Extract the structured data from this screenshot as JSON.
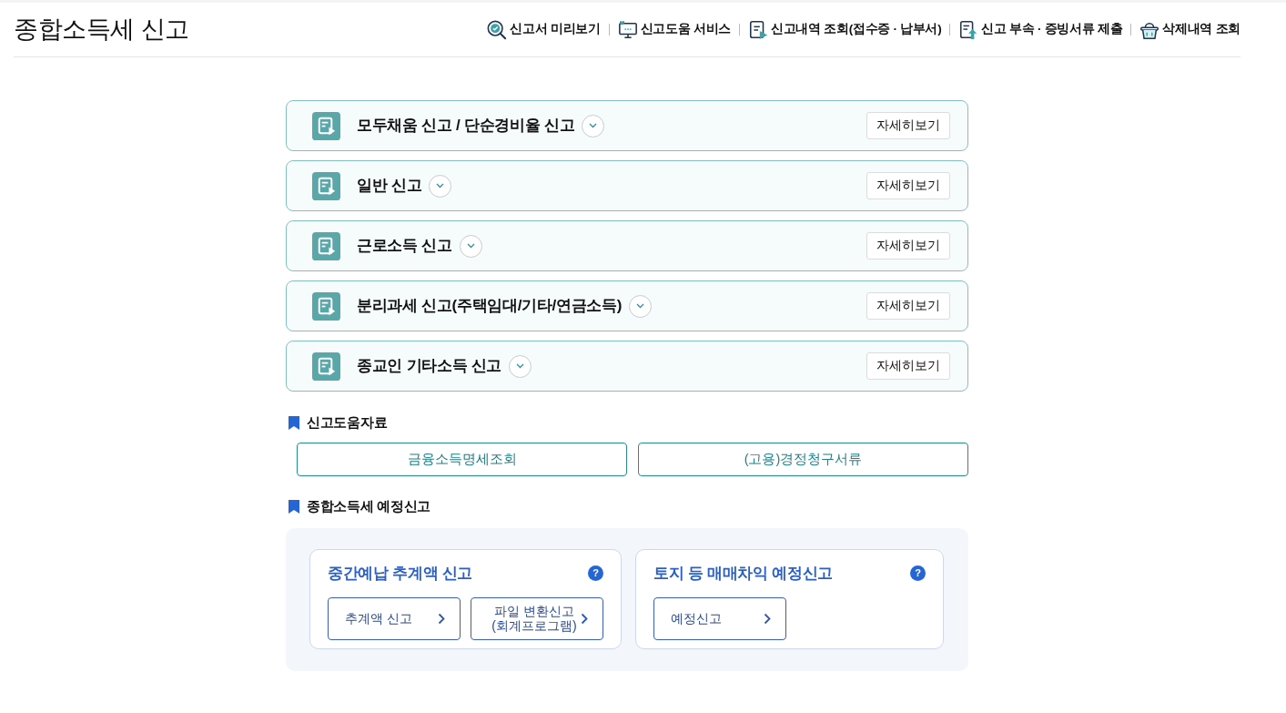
{
  "page_title": "종합소득세 신고",
  "header_links": [
    {
      "label": "신고서 미리보기"
    },
    {
      "label": "신고도움 서비스"
    },
    {
      "label": "신고내역 조회(접수증 · 납부서)"
    },
    {
      "label": "신고 부속 · 증빙서류 제출"
    },
    {
      "label": "삭제내역 조회"
    }
  ],
  "filing_types": [
    {
      "title": "모두채움 신고 / 단순경비율 신고",
      "expanded": false,
      "button": "자세히보기"
    },
    {
      "title": "일반 신고",
      "expanded": false,
      "button": "자세히보기"
    },
    {
      "title": "근로소득 신고",
      "expanded": false,
      "button": "자세히보기"
    },
    {
      "title": "분리과세 신고(주택임대/기타/연금소득)",
      "expanded": false,
      "button": "자세히보기"
    },
    {
      "title": "종교인 기타소득 신고",
      "expanded": false,
      "button": "자세히보기"
    }
  ],
  "help_materials": {
    "heading": "신고도움자료",
    "buttons": [
      "금융소득명세조회",
      "(고용)경정청구서류"
    ]
  },
  "provisional_filing": {
    "heading": "종합소득세 예정신고",
    "cards": [
      {
        "title": "중간예납 추계액 신고",
        "help": "?",
        "buttons": [
          "추계액 신고",
          "파일 변환신고\n(회계프로그램)"
        ]
      },
      {
        "title": "토지 등 매매차익 예정신고",
        "help": "?",
        "buttons": [
          "예정신고"
        ]
      }
    ]
  }
}
